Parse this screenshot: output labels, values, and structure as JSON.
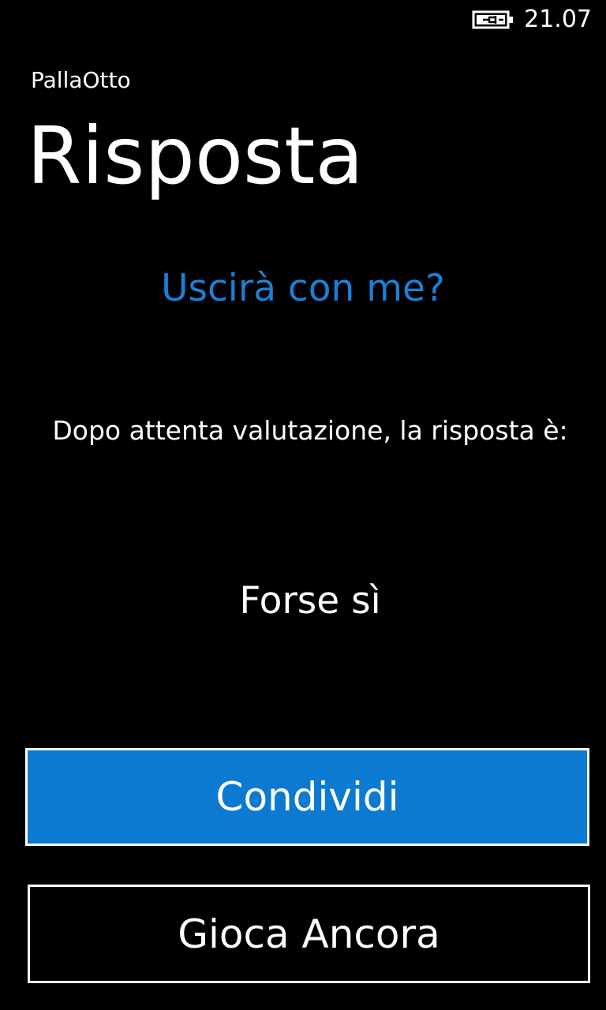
{
  "status_bar": {
    "battery_icon": "battery-charging-icon",
    "time": "21.07"
  },
  "app": {
    "name": "PallaOtto"
  },
  "page": {
    "title": "Risposta"
  },
  "content": {
    "question": "Uscirà con me?",
    "intro": "Dopo attenta valutazione, la risposta è:",
    "answer": "Forse sì"
  },
  "buttons": {
    "share_label": "Condividi",
    "replay_label": "Gioca Ancora"
  },
  "colors": {
    "accent": "#0b7ad0",
    "question_text": "#1a80d5",
    "background": "#000000",
    "foreground": "#ffffff"
  }
}
